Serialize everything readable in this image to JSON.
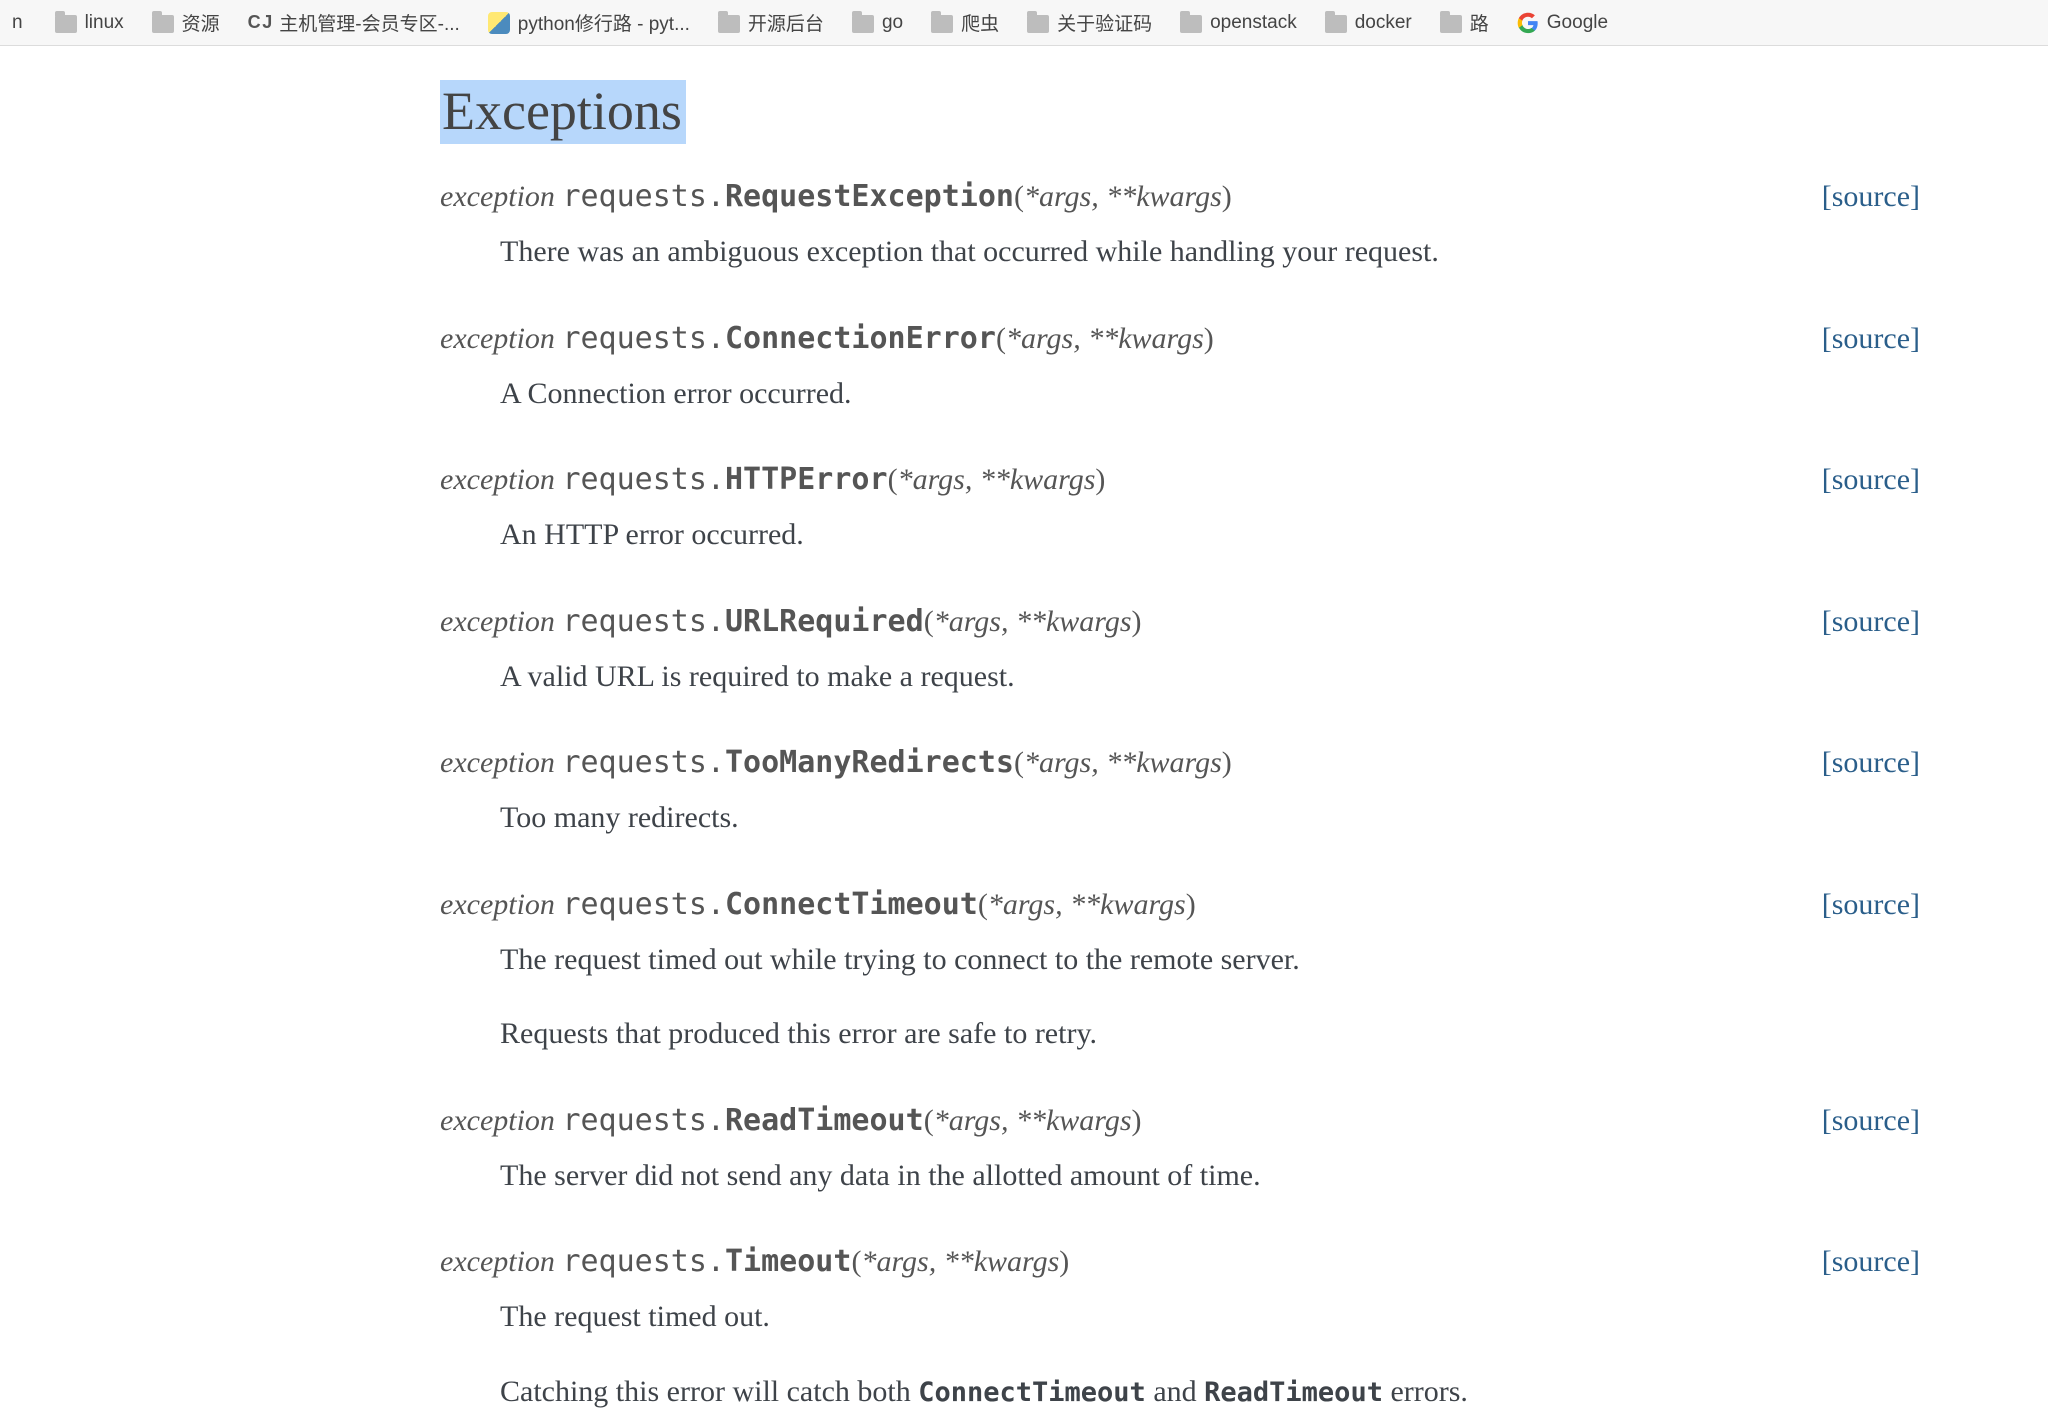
{
  "bookmarks": {
    "leading_fragment": "n",
    "items": [
      {
        "icon": "folder",
        "label": "linux"
      },
      {
        "icon": "folder",
        "label": "资源"
      },
      {
        "icon": "c",
        "label": "主机管理-会员专区-..."
      },
      {
        "icon": "py",
        "label": "python修行路 - pyt..."
      },
      {
        "icon": "folder",
        "label": "开源后台"
      },
      {
        "icon": "folder",
        "label": "go"
      },
      {
        "icon": "folder",
        "label": "爬虫"
      },
      {
        "icon": "folder",
        "label": "关于验证码"
      },
      {
        "icon": "folder",
        "label": "openstack"
      },
      {
        "icon": "folder",
        "label": "docker"
      },
      {
        "icon": "folder",
        "label": "路"
      },
      {
        "icon": "google",
        "label": "Google"
      }
    ]
  },
  "doc": {
    "section_title": "Exceptions",
    "keyword": "exception",
    "module_prefix": "requests.",
    "open_paren": "(",
    "args_star": "*args",
    "args_sep": ", ",
    "args_dstar": "**kwargs",
    "close_paren": ")",
    "source_label": "[source]",
    "and_word": " and ",
    "errors_suffix": " errors.",
    "entries": [
      {
        "classname": "RequestException",
        "desc": [
          "There was an ambiguous exception that occurred while handling your request."
        ]
      },
      {
        "classname": "ConnectionError",
        "desc": [
          "A Connection error occurred."
        ]
      },
      {
        "classname": "HTTPError",
        "desc": [
          "An HTTP error occurred."
        ]
      },
      {
        "classname": "URLRequired",
        "desc": [
          "A valid URL is required to make a request."
        ]
      },
      {
        "classname": "TooManyRedirects",
        "desc": [
          "Too many redirects."
        ]
      },
      {
        "classname": "ConnectTimeout",
        "desc": [
          "The request timed out while trying to connect to the remote server.",
          "Requests that produced this error are safe to retry."
        ]
      },
      {
        "classname": "ReadTimeout",
        "desc": [
          "The server did not send any data in the allotted amount of time."
        ]
      },
      {
        "classname": "Timeout",
        "desc": [
          "The request timed out."
        ],
        "catch_prefix": "Catching this error will catch both ",
        "catch_ref1": "ConnectTimeout",
        "catch_ref2": "ReadTimeout"
      }
    ]
  }
}
